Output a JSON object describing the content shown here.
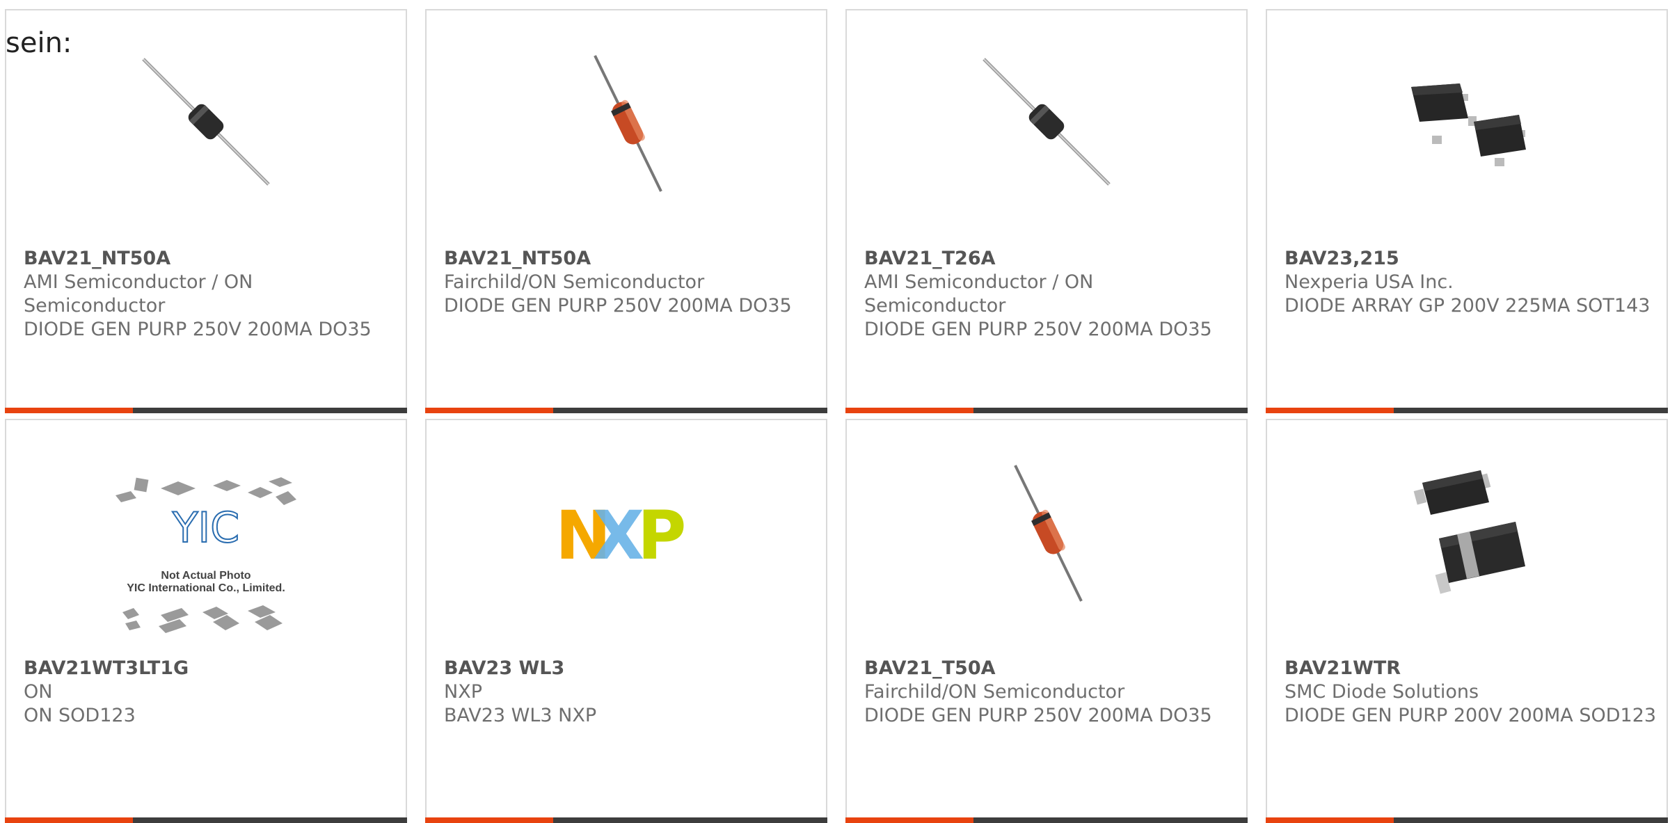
{
  "intro_text": "sein:",
  "products": [
    {
      "part": "BAV21_NT50A",
      "maker": "AMI Semiconductor / ON Semiconductor",
      "desc": "DIODE GEN PURP 250V 200MA DO35",
      "image": "axial-diode-black-icon"
    },
    {
      "part": "BAV21_NT50A",
      "maker": "Fairchild/ON Semiconductor",
      "desc": "DIODE GEN PURP 250V 200MA DO35",
      "image": "glass-diode-icon"
    },
    {
      "part": "BAV21_T26A",
      "maker": "AMI Semiconductor / ON Semiconductor",
      "desc": "DIODE GEN PURP 250V 200MA DO35",
      "image": "axial-diode-black-icon"
    },
    {
      "part": "BAV23,215",
      "maker": "Nexperia USA Inc.",
      "desc": "DIODE ARRAY GP 200V 225MA SOT143",
      "image": "sot143-package-icon"
    },
    {
      "part": "BAV21WT3LT1G",
      "maker": "ON",
      "desc": "ON SOD123",
      "image": "not-actual-photo-placeholder",
      "placeholder_line1": "Not Actual Photo",
      "placeholder_line2": "YIC International Co., Limited.",
      "placeholder_logo": "YIC"
    },
    {
      "part": "BAV23 WL3",
      "maker": "NXP",
      "desc": "BAV23 WL3 NXP",
      "image": "nxp-logo"
    },
    {
      "part": "BAV21_T50A",
      "maker": "Fairchild/ON Semiconductor",
      "desc": "DIODE GEN PURP 250V 200MA DO35",
      "image": "glass-diode-icon"
    },
    {
      "part": "BAV21WTR",
      "maker": "SMC Diode Solutions",
      "desc": "DIODE GEN PURP 200V 200MA SOD123",
      "image": "sod123-package-icon"
    }
  ],
  "colors": {
    "accent": "#e8430f",
    "bar": "#3d3d3d",
    "border": "#d9d9d9",
    "text": "#6e6e6e"
  },
  "nxp_logo": {
    "letters": "NXP",
    "colors": [
      "#f5a800",
      "#69b3e7",
      "#c4d600"
    ]
  }
}
